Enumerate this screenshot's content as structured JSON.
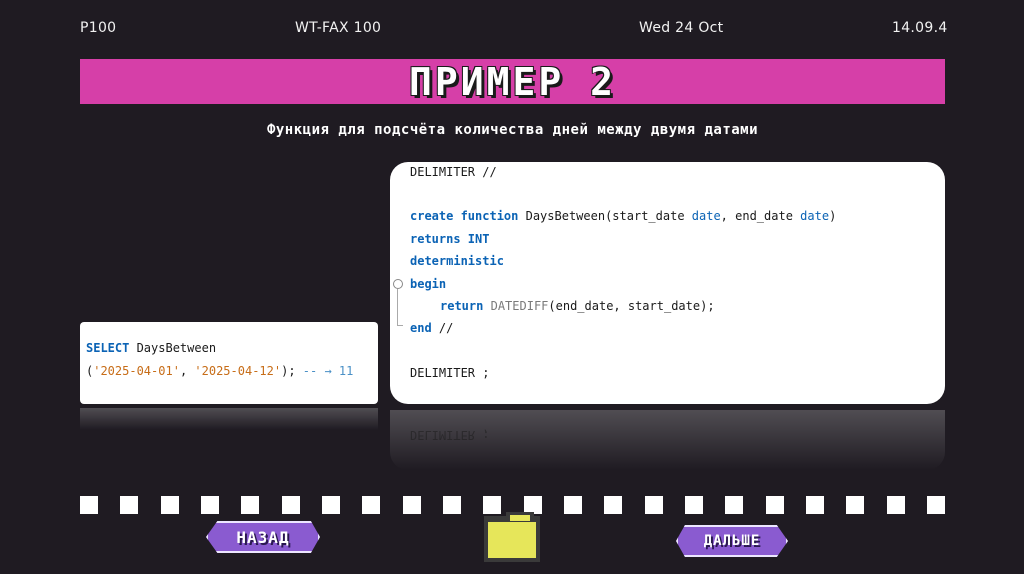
{
  "header": {
    "left": "P100",
    "center_left": "WT-FAX 100",
    "center_right": "Wed 24 Oct",
    "right": "14.09.4"
  },
  "banner": {
    "title": "ПРИМЕР 2"
  },
  "subtitle": "Функция для подсчёта количества дней между двумя датами",
  "main_code": {
    "l1": "DELIMITER //",
    "l3_kw1": "create function",
    "l3_name": " DaysBetween(start_date ",
    "l3_t1": "date",
    "l3_mid": ", end_date ",
    "l3_t2": "date",
    "l3_end": ")",
    "l4": "returns INT",
    "l5": "deterministic",
    "l6": "begin",
    "l7_kw": "return",
    "l7_fn": "DATEDIFF",
    "l7_args": "(end_date, start_date);",
    "l8_kw": "end",
    "l8_rest": " //",
    "l10": "DELIMITER ;"
  },
  "small_code": {
    "kw": "SELECT",
    "name": " DaysBetween",
    "open": "(",
    "s1": "'2025-04-01'",
    "comma": ", ",
    "s2": "'2025-04-12'",
    "close": ");",
    "comment": " -- → 11"
  },
  "reflection_text": "DELIMITER ;",
  "nav": {
    "back": "НАЗАД",
    "next": "ДАЛЬШЕ"
  },
  "icons": {
    "folder": "folder-icon"
  },
  "colors": {
    "banner": "#d63fa8",
    "button": "#8a5bd0",
    "folder": "#e6e65a",
    "background": "#1f1b22"
  }
}
